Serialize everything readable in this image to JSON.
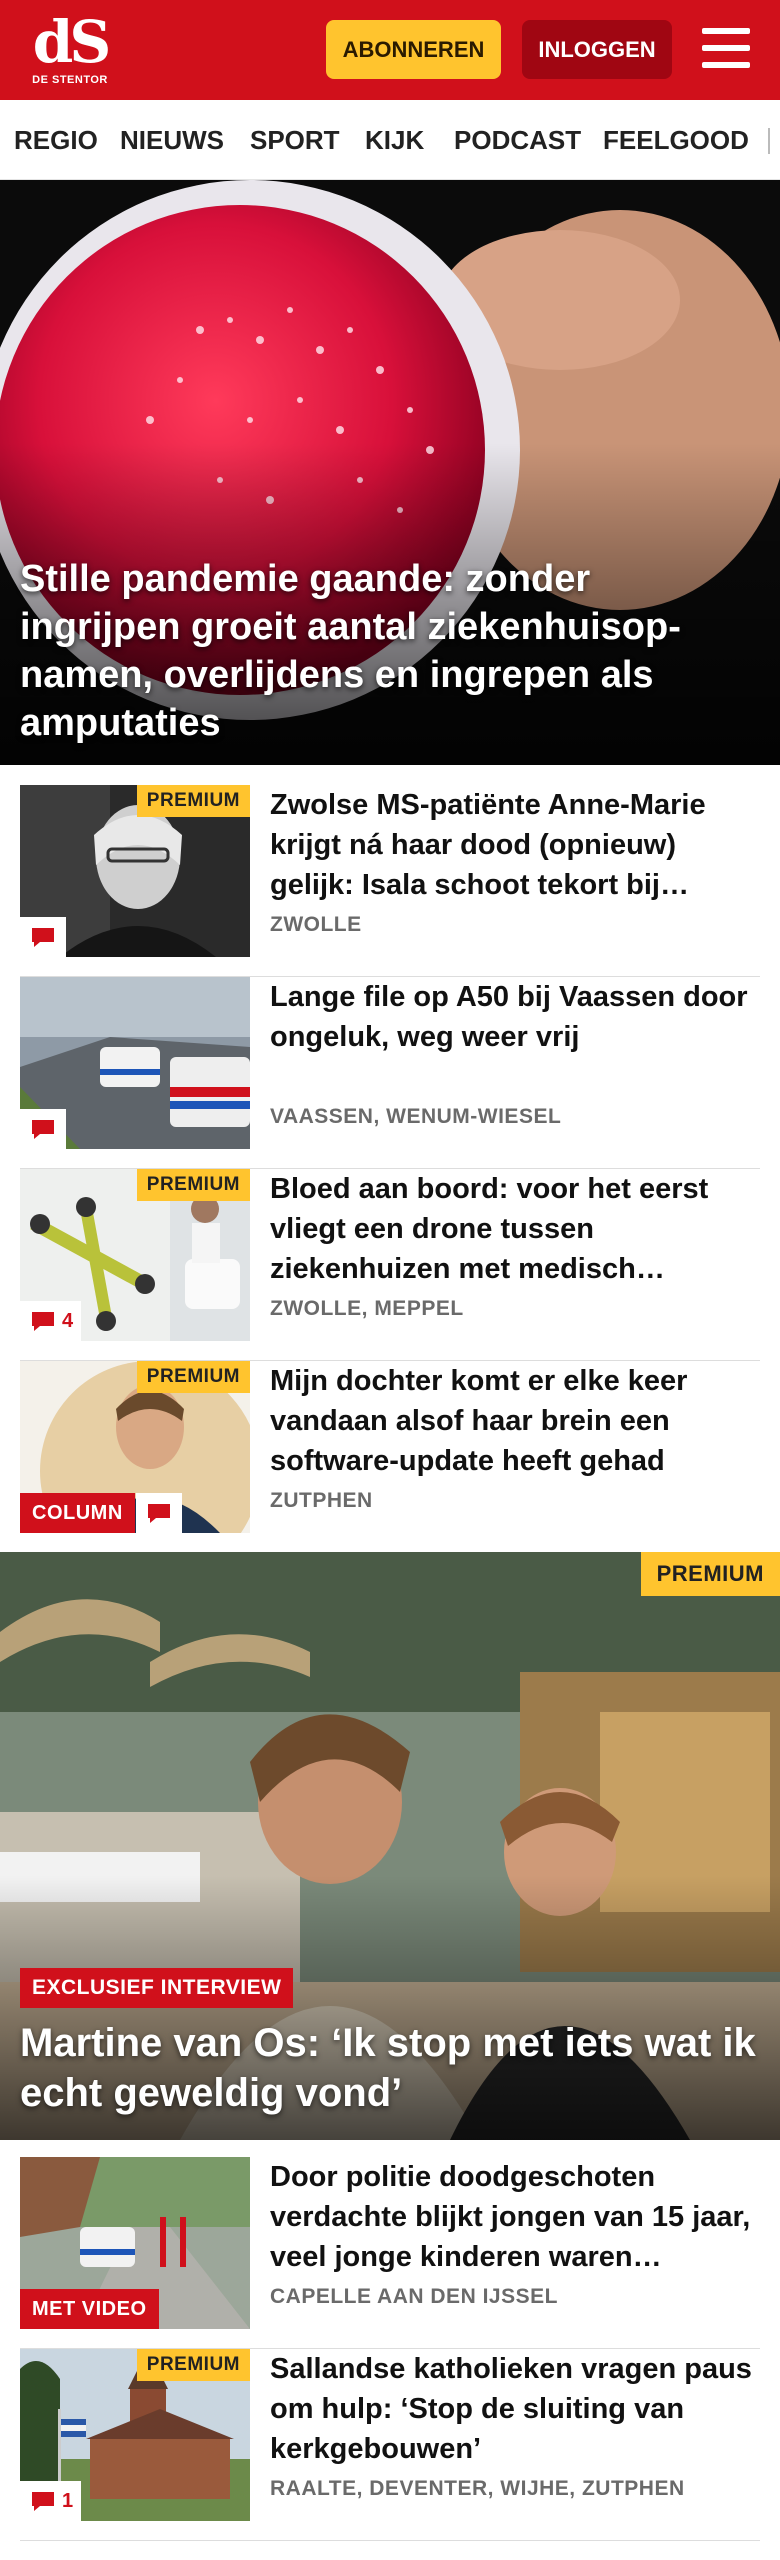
{
  "header": {
    "logo_mark": "dS",
    "logo_sub": "DE STENTOR",
    "subscribe_label": "ABONNEREN",
    "login_label": "INLOGGEN",
    "brand_color": "#d0101b",
    "accent_color": "#ffc42e"
  },
  "nav": {
    "items": [
      "REGIO",
      "NIEUWS",
      "SPORT",
      "KIJK",
      "PODCAST",
      "FEELGOOD"
    ]
  },
  "hero": {
    "title": "Stille pandemie gaande: zonder ingrijpen groeit aantal ziekenhuisop­namen, overlijdens en ingrepen als amputaties"
  },
  "articles": [
    {
      "title": "Zwolse MS-patiënte Anne-Marie krijgt ná haar dood (opnieuw) gelijk: Isala schoot tekort bij…",
      "location": "ZWOLLE",
      "premium": "PREMIUM"
    },
    {
      "title": "Lange file op A50 bij Vaassen door ongeluk, weg weer vrij",
      "location": "VAASSEN, WENUM-WIESEL"
    },
    {
      "title": "Bloed aan boord: voor het eerst vliegt een drone tussen ziekenhuizen met medisch…",
      "location": "ZWOLLE, MEPPEL",
      "premium": "PREMIUM",
      "comments": "4"
    },
    {
      "title": "Mijn dochter komt er elke keer vandaan alsof haar brein een software-update heeft gehad",
      "location": "ZUTPHEN",
      "premium": "PREMIUM",
      "badge": "COLUMN"
    }
  ],
  "feature": {
    "premium": "PREMIUM",
    "kicker": "EXCLUSIEF INTERVIEW",
    "title": "Martine van Os: ‘Ik stop met iets wat ik echt geweldig vond’"
  },
  "articles2": [
    {
      "title": "Door politie doodgeschoten verdachte blijkt jongen van 15 jaar, veel jonge kinderen waren…",
      "location": "CAPELLE AAN DEN IJSSEL",
      "badge": "MET VIDEO"
    },
    {
      "title": "Sallandse katholieken vragen paus om hulp: ‘Stop de sluiting van kerkgebouwen’",
      "location": "RAALTE, DEVENTER, WIJHE, ZUTPHEN",
      "premium": "PREMIUM",
      "comments": "1"
    }
  ]
}
